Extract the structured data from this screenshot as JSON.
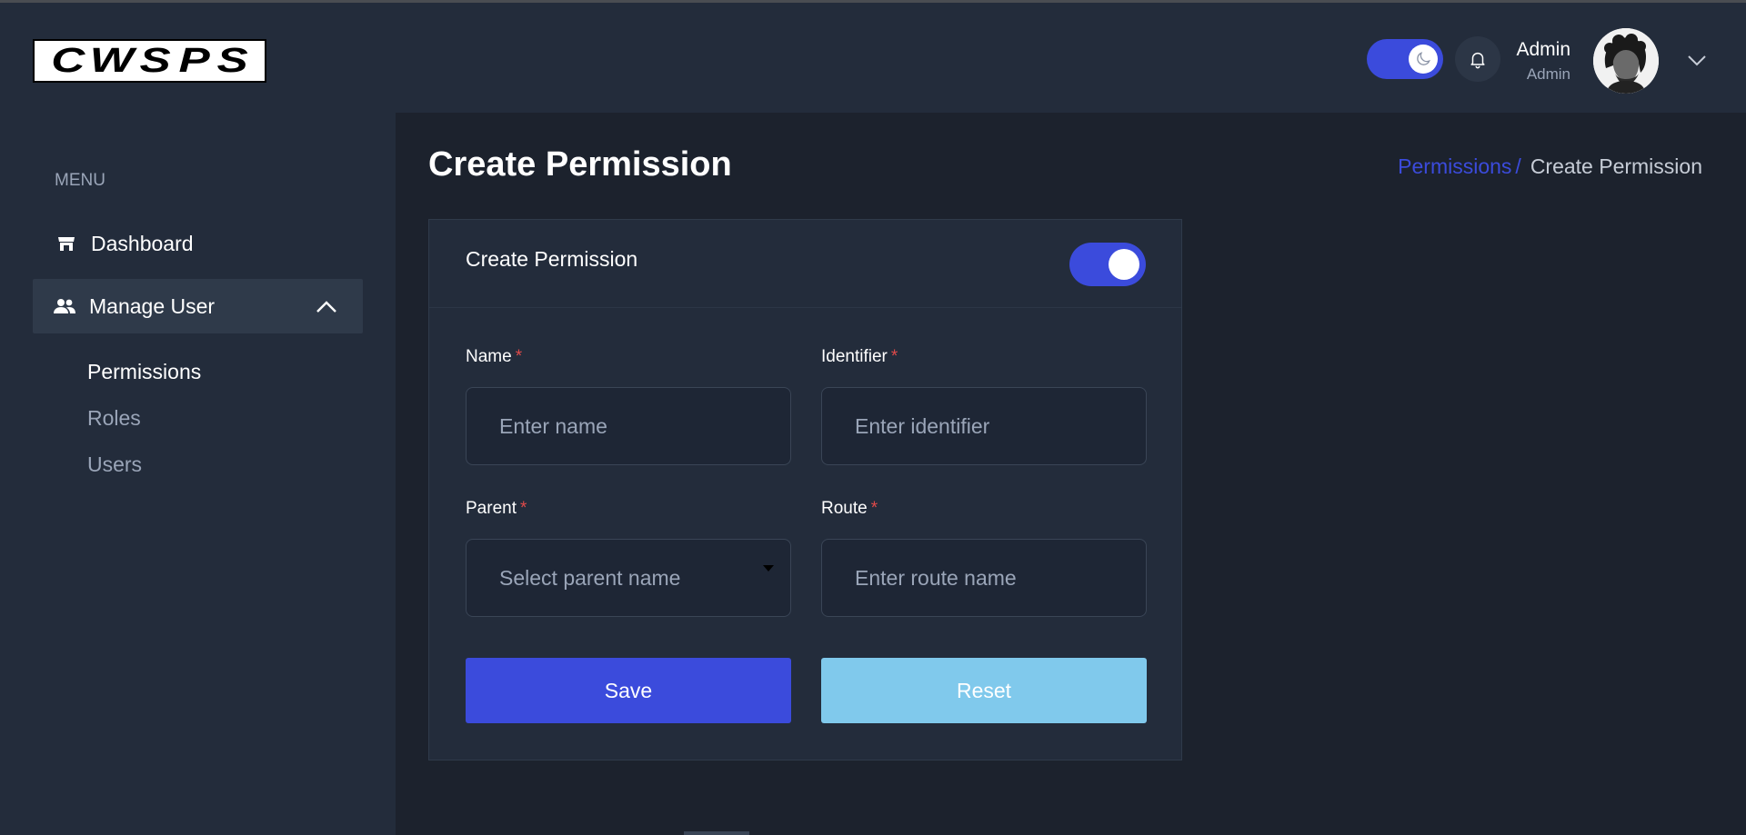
{
  "brand": {
    "logo_text": [
      "C",
      "W",
      "S",
      "P",
      "S"
    ]
  },
  "header": {
    "user_name": "Admin",
    "user_role": "Admin"
  },
  "sidebar": {
    "menu_label": "MENU",
    "items": [
      {
        "label": "Dashboard",
        "icon": "store-icon"
      },
      {
        "label": "Manage User",
        "icon": "users-icon",
        "expanded": true,
        "children": [
          {
            "label": "Permissions",
            "active": true
          },
          {
            "label": "Roles"
          },
          {
            "label": "Users"
          }
        ]
      }
    ]
  },
  "page": {
    "title": "Create Permission",
    "breadcrumb": {
      "link": "Permissions",
      "separator": "/",
      "current": "Create Permission"
    }
  },
  "form": {
    "card_title": "Create Permission",
    "status_toggle_on": true,
    "fields": {
      "name": {
        "label": "Name",
        "required": "*",
        "placeholder": "Enter name",
        "value": ""
      },
      "identifier": {
        "label": "Identifier",
        "required": "*",
        "placeholder": "Enter identifier",
        "value": ""
      },
      "parent": {
        "label": "Parent",
        "required": "*",
        "selected": "Select parent name"
      },
      "route": {
        "label": "Route",
        "required": "*",
        "placeholder": "Enter route name",
        "value": ""
      }
    },
    "buttons": {
      "save": "Save",
      "reset": "Reset"
    }
  },
  "colors": {
    "accent": "#3b4bdc",
    "reset": "#80c9ec",
    "required": "#e04a4a",
    "panel": "#232c3b",
    "background": "#1c222d"
  }
}
